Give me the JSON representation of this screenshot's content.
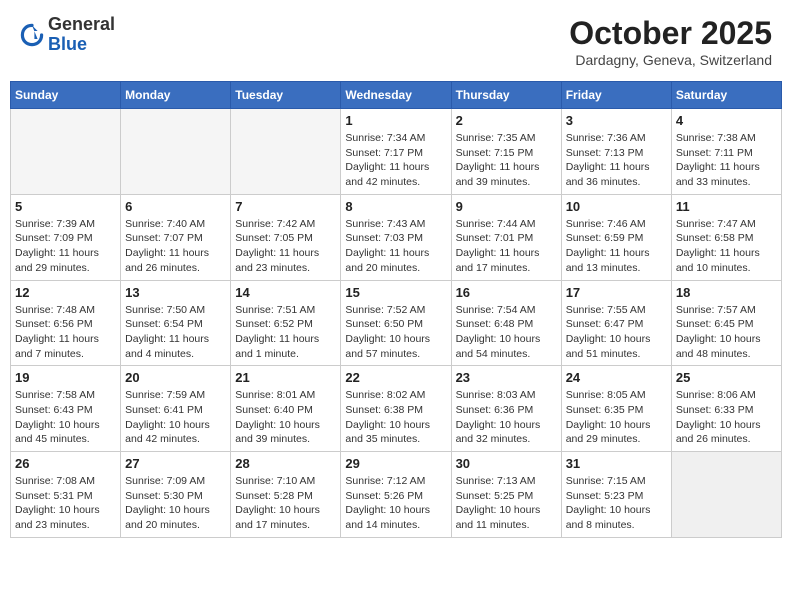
{
  "header": {
    "logo_general": "General",
    "logo_blue": "Blue",
    "month": "October 2025",
    "location": "Dardagny, Geneva, Switzerland"
  },
  "weekdays": [
    "Sunday",
    "Monday",
    "Tuesday",
    "Wednesday",
    "Thursday",
    "Friday",
    "Saturday"
  ],
  "weeks": [
    [
      {
        "day": "",
        "empty": true
      },
      {
        "day": "",
        "empty": true
      },
      {
        "day": "",
        "empty": true
      },
      {
        "day": "1",
        "sunrise": "Sunrise: 7:34 AM",
        "sunset": "Sunset: 7:17 PM",
        "daylight": "Daylight: 11 hours and 42 minutes."
      },
      {
        "day": "2",
        "sunrise": "Sunrise: 7:35 AM",
        "sunset": "Sunset: 7:15 PM",
        "daylight": "Daylight: 11 hours and 39 minutes."
      },
      {
        "day": "3",
        "sunrise": "Sunrise: 7:36 AM",
        "sunset": "Sunset: 7:13 PM",
        "daylight": "Daylight: 11 hours and 36 minutes."
      },
      {
        "day": "4",
        "sunrise": "Sunrise: 7:38 AM",
        "sunset": "Sunset: 7:11 PM",
        "daylight": "Daylight: 11 hours and 33 minutes."
      }
    ],
    [
      {
        "day": "5",
        "sunrise": "Sunrise: 7:39 AM",
        "sunset": "Sunset: 7:09 PM",
        "daylight": "Daylight: 11 hours and 29 minutes."
      },
      {
        "day": "6",
        "sunrise": "Sunrise: 7:40 AM",
        "sunset": "Sunset: 7:07 PM",
        "daylight": "Daylight: 11 hours and 26 minutes."
      },
      {
        "day": "7",
        "sunrise": "Sunrise: 7:42 AM",
        "sunset": "Sunset: 7:05 PM",
        "daylight": "Daylight: 11 hours and 23 minutes."
      },
      {
        "day": "8",
        "sunrise": "Sunrise: 7:43 AM",
        "sunset": "Sunset: 7:03 PM",
        "daylight": "Daylight: 11 hours and 20 minutes."
      },
      {
        "day": "9",
        "sunrise": "Sunrise: 7:44 AM",
        "sunset": "Sunset: 7:01 PM",
        "daylight": "Daylight: 11 hours and 17 minutes."
      },
      {
        "day": "10",
        "sunrise": "Sunrise: 7:46 AM",
        "sunset": "Sunset: 6:59 PM",
        "daylight": "Daylight: 11 hours and 13 minutes."
      },
      {
        "day": "11",
        "sunrise": "Sunrise: 7:47 AM",
        "sunset": "Sunset: 6:58 PM",
        "daylight": "Daylight: 11 hours and 10 minutes."
      }
    ],
    [
      {
        "day": "12",
        "sunrise": "Sunrise: 7:48 AM",
        "sunset": "Sunset: 6:56 PM",
        "daylight": "Daylight: 11 hours and 7 minutes."
      },
      {
        "day": "13",
        "sunrise": "Sunrise: 7:50 AM",
        "sunset": "Sunset: 6:54 PM",
        "daylight": "Daylight: 11 hours and 4 minutes."
      },
      {
        "day": "14",
        "sunrise": "Sunrise: 7:51 AM",
        "sunset": "Sunset: 6:52 PM",
        "daylight": "Daylight: 11 hours and 1 minute."
      },
      {
        "day": "15",
        "sunrise": "Sunrise: 7:52 AM",
        "sunset": "Sunset: 6:50 PM",
        "daylight": "Daylight: 10 hours and 57 minutes."
      },
      {
        "day": "16",
        "sunrise": "Sunrise: 7:54 AM",
        "sunset": "Sunset: 6:48 PM",
        "daylight": "Daylight: 10 hours and 54 minutes."
      },
      {
        "day": "17",
        "sunrise": "Sunrise: 7:55 AM",
        "sunset": "Sunset: 6:47 PM",
        "daylight": "Daylight: 10 hours and 51 minutes."
      },
      {
        "day": "18",
        "sunrise": "Sunrise: 7:57 AM",
        "sunset": "Sunset: 6:45 PM",
        "daylight": "Daylight: 10 hours and 48 minutes."
      }
    ],
    [
      {
        "day": "19",
        "sunrise": "Sunrise: 7:58 AM",
        "sunset": "Sunset: 6:43 PM",
        "daylight": "Daylight: 10 hours and 45 minutes."
      },
      {
        "day": "20",
        "sunrise": "Sunrise: 7:59 AM",
        "sunset": "Sunset: 6:41 PM",
        "daylight": "Daylight: 10 hours and 42 minutes."
      },
      {
        "day": "21",
        "sunrise": "Sunrise: 8:01 AM",
        "sunset": "Sunset: 6:40 PM",
        "daylight": "Daylight: 10 hours and 39 minutes."
      },
      {
        "day": "22",
        "sunrise": "Sunrise: 8:02 AM",
        "sunset": "Sunset: 6:38 PM",
        "daylight": "Daylight: 10 hours and 35 minutes."
      },
      {
        "day": "23",
        "sunrise": "Sunrise: 8:03 AM",
        "sunset": "Sunset: 6:36 PM",
        "daylight": "Daylight: 10 hours and 32 minutes."
      },
      {
        "day": "24",
        "sunrise": "Sunrise: 8:05 AM",
        "sunset": "Sunset: 6:35 PM",
        "daylight": "Daylight: 10 hours and 29 minutes."
      },
      {
        "day": "25",
        "sunrise": "Sunrise: 8:06 AM",
        "sunset": "Sunset: 6:33 PM",
        "daylight": "Daylight: 10 hours and 26 minutes."
      }
    ],
    [
      {
        "day": "26",
        "sunrise": "Sunrise: 7:08 AM",
        "sunset": "Sunset: 5:31 PM",
        "daylight": "Daylight: 10 hours and 23 minutes."
      },
      {
        "day": "27",
        "sunrise": "Sunrise: 7:09 AM",
        "sunset": "Sunset: 5:30 PM",
        "daylight": "Daylight: 10 hours and 20 minutes."
      },
      {
        "day": "28",
        "sunrise": "Sunrise: 7:10 AM",
        "sunset": "Sunset: 5:28 PM",
        "daylight": "Daylight: 10 hours and 17 minutes."
      },
      {
        "day": "29",
        "sunrise": "Sunrise: 7:12 AM",
        "sunset": "Sunset: 5:26 PM",
        "daylight": "Daylight: 10 hours and 14 minutes."
      },
      {
        "day": "30",
        "sunrise": "Sunrise: 7:13 AM",
        "sunset": "Sunset: 5:25 PM",
        "daylight": "Daylight: 10 hours and 11 minutes."
      },
      {
        "day": "31",
        "sunrise": "Sunrise: 7:15 AM",
        "sunset": "Sunset: 5:23 PM",
        "daylight": "Daylight: 10 hours and 8 minutes."
      },
      {
        "day": "",
        "empty": true,
        "gray": true
      }
    ]
  ]
}
